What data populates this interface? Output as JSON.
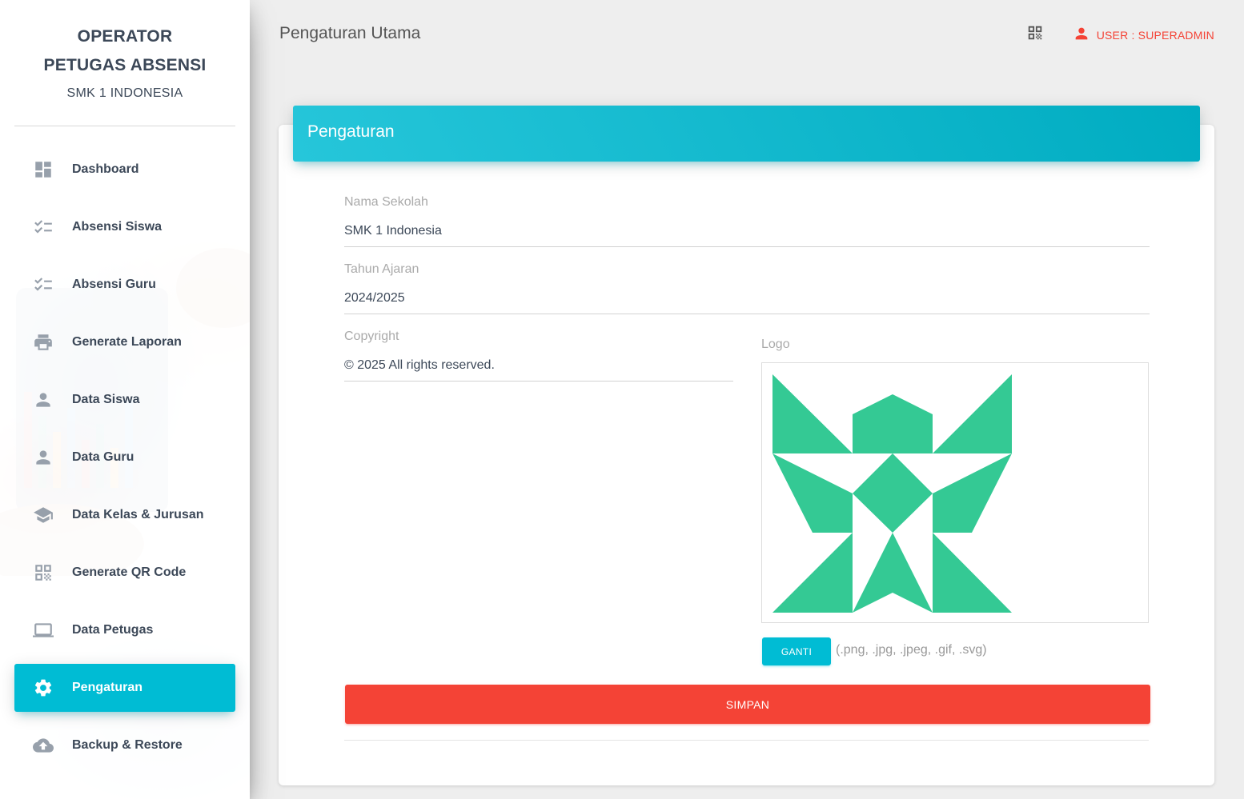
{
  "sidebar": {
    "brand_line1": "OPERATOR",
    "brand_line2": "PETUGAS ABSENSI",
    "brand_school": "SMK 1 INDONESIA",
    "items": [
      {
        "label": "Dashboard",
        "icon": "dashboard-icon"
      },
      {
        "label": "Absensi Siswa",
        "icon": "checklist-icon"
      },
      {
        "label": "Absensi Guru",
        "icon": "checklist-icon"
      },
      {
        "label": "Generate Laporan",
        "icon": "print-icon"
      },
      {
        "label": "Data Siswa",
        "icon": "person-icon"
      },
      {
        "label": "Data Guru",
        "icon": "person-icon"
      },
      {
        "label": "Data Kelas & Jurusan",
        "icon": "school-icon"
      },
      {
        "label": "Generate QR Code",
        "icon": "qr-code-icon"
      },
      {
        "label": "Data Petugas",
        "icon": "laptop-icon"
      },
      {
        "label": "Pengaturan",
        "icon": "settings-icon",
        "active": true
      },
      {
        "label": "Backup & Restore",
        "icon": "cloud-upload-icon"
      }
    ],
    "active_color": "#00bcd4"
  },
  "header": {
    "title": "Pengaturan Utama",
    "qr_icon": "qr-code-icon",
    "user_label": "USER : SUPERADMIN",
    "user_color": "#f44336"
  },
  "card": {
    "title": "Pengaturan",
    "fields": {
      "nama_sekolah": {
        "label": "Nama Sekolah",
        "value": "SMK 1 Indonesia"
      },
      "tahun_ajaran": {
        "label": "Tahun Ajaran",
        "value": "2024/2025"
      },
      "copyright": {
        "label": "Copyright",
        "value": "© 2025 All rights reserved."
      }
    },
    "logo": {
      "label": "Logo",
      "color": "#34c994",
      "button_label": "GANTI",
      "hint": "(.png, .jpg, .jpeg, .gif, .svg)"
    },
    "save_label": "SIMPAN",
    "save_color": "#f44336"
  }
}
